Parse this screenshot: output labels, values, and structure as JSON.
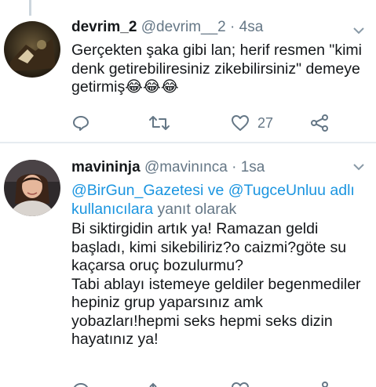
{
  "tweets": [
    {
      "display_name": "devrim_2",
      "handle": "@devrim__2",
      "time": "· 4sa",
      "text": "Gerçekten şaka gibi lan; herif resmen \"kimi denk getirebiliresiniz zikebilirsiniz\" demeye getirmiş😂😂😂",
      "actions": {
        "like_count": "27"
      }
    },
    {
      "display_name": "mavininja",
      "handle": "@mavinınca",
      "time": "· 1sa",
      "reply_to": {
        "mention1": "@BirGun_Gazetesi",
        "connector": "ve",
        "mention2": "@TugceUnluu",
        "suffix_link": "adlı kullanıcılara",
        "suffix_text": "yanıt olarak"
      },
      "text": "Bi siktirgidin artık ya! Ramazan geldi başladı, kimi sikebiliriz?o caizmi?göte su kaçarsa oruç bozulurmu?\nTabi ablayı istemeye geldiler begenmediler hepiniz grup yaparsınız amk yobazları!hepmi seks hepmi seks dizin hayatınız ya!"
    }
  ],
  "icons": [
    "reply-icon",
    "retweet-icon",
    "like-icon",
    "share-icon",
    "caret-down-icon"
  ],
  "colors": {
    "link": "#1b95e0",
    "muted": "#657786",
    "divider": "#e6ecf0"
  }
}
